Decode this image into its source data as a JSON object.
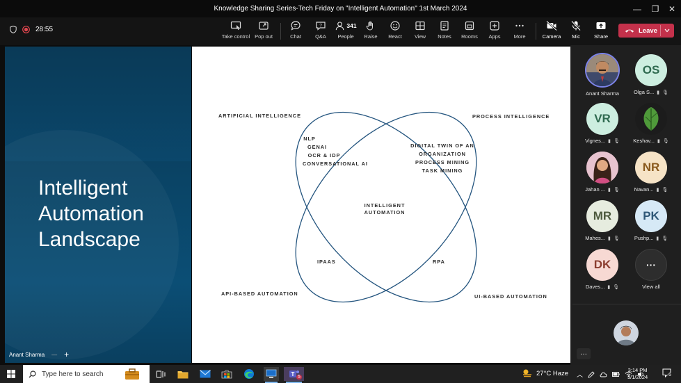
{
  "window": {
    "title": "Knowledge Sharing Series-Tech Friday on \"Intelligent Automation\" 1st March 2024",
    "minimize": "—",
    "maximize": "❐",
    "close": "✕"
  },
  "meeting": {
    "elapsed": "28:55"
  },
  "toolbar": {
    "take_control": "Take control",
    "pop_out": "Pop out",
    "chat": "Chat",
    "qa": "Q&A",
    "people": "People",
    "people_count": "341",
    "raise": "Raise",
    "react": "React",
    "view": "View",
    "notes": "Notes",
    "rooms": "Rooms",
    "apps": "Apps",
    "more": "More",
    "camera": "Camera",
    "mic": "Mic",
    "share": "Share",
    "leave": "Leave"
  },
  "slide": {
    "title_line1": "Intelligent",
    "title_line2": "Automation",
    "title_line3": "Landscape",
    "diagram": {
      "ai": "ARTIFICIAL INTELLIGENCE",
      "pi": "PROCESS INTELLIGENCE",
      "api": "API-BASED AUTOMATION",
      "ui": "UI-BASED AUTOMATION",
      "ai_items": [
        "NLP",
        "GENAI",
        "OCR & IDP",
        "CONVERSATIONAL AI"
      ],
      "pi_items": [
        "DIGITAL TWIN OF AN",
        "ORGANIZATION",
        "PROCESS MINING",
        "TASK MINING"
      ],
      "center_line1": "INTELLIGENT",
      "center_line2": "AUTOMATION",
      "ipaas": "IPAAS",
      "rpa": "RPA"
    }
  },
  "presenter": {
    "name": "Anant Sharma"
  },
  "participants": [
    {
      "name": "Anant Sharma",
      "initials": "",
      "color": "#8a6a4a"
    },
    {
      "name": "Olga S...",
      "initials": "OS",
      "color": "#cdeee0"
    },
    {
      "name": "Vignes...",
      "initials": "VR",
      "color": "#cdeee0"
    },
    {
      "name": "Keshav...",
      "initials": "",
      "color": "#2b2b2b"
    },
    {
      "name": "Jahan ...",
      "initials": "",
      "color": "#d88aa5"
    },
    {
      "name": "Navan...",
      "initials": "NR",
      "color": "#f6e3c6"
    },
    {
      "name": "Mahes...",
      "initials": "MR",
      "color": "#e6ecdf"
    },
    {
      "name": "Pushp...",
      "initials": "PK",
      "color": "#d6e9f6"
    },
    {
      "name": "Daves...",
      "initials": "DK",
      "color": "#f7d9d3"
    },
    {
      "name": "View all",
      "initials": "···",
      "color": "#2d2d2d"
    }
  ],
  "taskbar": {
    "search_placeholder": "Type here to search",
    "weather": "27°C  Haze",
    "time": "3:14 PM",
    "date": "3/1/2024",
    "notifications": "6",
    "teams_badge": "5"
  }
}
